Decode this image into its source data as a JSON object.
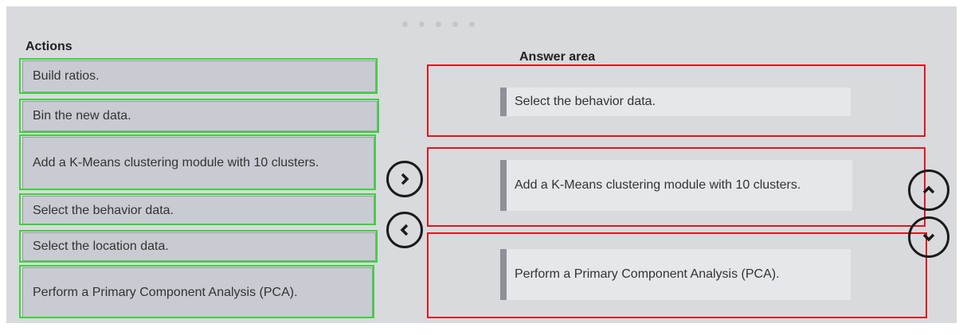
{
  "actions": {
    "title": "Actions",
    "items": [
      {
        "label": "Build ratios."
      },
      {
        "label": "Bin the new data."
      },
      {
        "label": "Add a K-Means clustering module with 10 clusters."
      },
      {
        "label": "Select the behavior data."
      },
      {
        "label": "Select the location data."
      },
      {
        "label": "Perform a Primary Component Analysis (PCA)."
      }
    ]
  },
  "answer_area": {
    "title": "Answer area",
    "items": [
      {
        "label": "Select the behavior data."
      },
      {
        "label": "Add a K-Means clustering module with 10 clusters."
      },
      {
        "label": "Perform a Primary Component Analysis (PCA)."
      }
    ]
  },
  "controls": {
    "move_right_icon": "chevron-right-icon",
    "move_left_icon": "chevron-left-icon",
    "move_up_icon": "chevron-up-icon",
    "move_down_icon": "chevron-down-icon"
  },
  "colors": {
    "actions_highlight": "#36d636",
    "answer_highlight": "#e3141c"
  }
}
